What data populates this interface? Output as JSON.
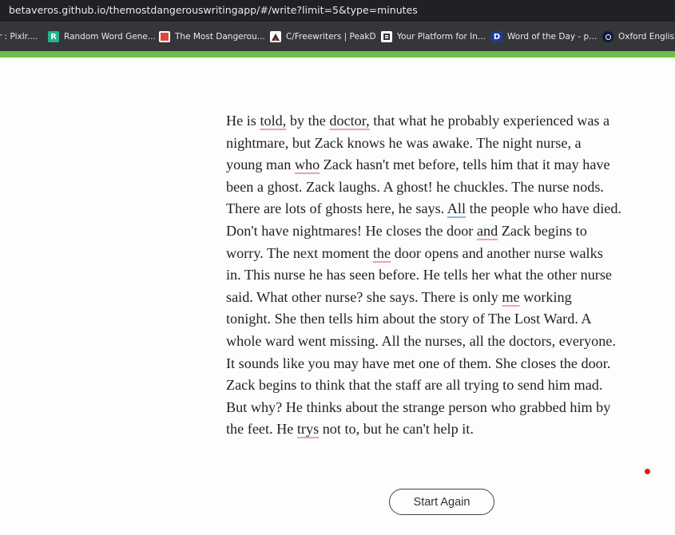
{
  "browser": {
    "url": "betaveros.github.io/themostdangerouswritingapp/#/write?limit=5&type=minutes",
    "bookmarks": [
      {
        "label": "r : Pixlr....",
        "icon": "pixlr-icon",
        "color": "#35363a"
      },
      {
        "label": "Random Word Gene...",
        "icon": "random-word-r-icon",
        "color": "#1fb58f",
        "letter": "R"
      },
      {
        "label": "The Most Dangerou...",
        "icon": "dangerous-writing-icon",
        "color": "#e0443b"
      },
      {
        "label": "C/Freewriters | PeakD",
        "icon": "peakd-icon",
        "color": "#ffffff"
      },
      {
        "label": "Your Platform for In...",
        "icon": "platform-b-icon",
        "color": "#ffffff"
      },
      {
        "label": "Word of the Day - p...",
        "icon": "dictionary-d-icon",
        "color": "#1a3d9c",
        "letter": "D"
      },
      {
        "label": "Oxford English",
        "icon": "oxford-icon",
        "color": "#0d1b3e"
      }
    ]
  },
  "progress": {
    "fraction": 1.0,
    "color": "#6cc04a"
  },
  "writing": {
    "lines": [
      [
        {
          "t": "He is "
        },
        {
          "t": "told,",
          "u": "sp"
        },
        {
          "t": " by the "
        },
        {
          "t": "doctor,",
          "u": "sp"
        },
        {
          "t": " that what he probably experienced was a"
        }
      ],
      [
        {
          "t": "nightmare, but Zack knows he was awake. The night nurse, a"
        }
      ],
      [
        {
          "t": "young man "
        },
        {
          "t": "who",
          "u": "sp"
        },
        {
          "t": " Zack hasn't met before, tells him that it may have"
        }
      ],
      [
        {
          "t": "been a ghost. Zack laughs. A ghost! he chuckles. The nurse nods."
        }
      ],
      [
        {
          "t": "There are lots of ghosts here, he says. "
        },
        {
          "t": "All",
          "u": "gr"
        },
        {
          "t": " the people who have died."
        }
      ],
      [
        {
          "t": "Don't have nightmares! He closes the door "
        },
        {
          "t": "and",
          "u": "sp"
        },
        {
          "t": " Zack begins to"
        }
      ],
      [
        {
          "t": "worry. The next moment "
        },
        {
          "t": "the",
          "u": "sp"
        },
        {
          "t": " door opens and another nurse walks"
        }
      ],
      [
        {
          "t": "in. This nurse he has seen before. He tells her what the other nurse"
        }
      ],
      [
        {
          "t": "said. What other nurse? she says. There is only "
        },
        {
          "t": "me",
          "u": "sp"
        },
        {
          "t": " working"
        }
      ],
      [
        {
          "t": "tonight. She then tells him about the story of The Lost Ward. A"
        }
      ],
      [
        {
          "t": "whole ward went missing. All the nurses, all the doctors, everyone."
        }
      ],
      [
        {
          "t": "It sounds like you may have met one of them. She closes the door."
        }
      ],
      [
        {
          "t": "Zack begins to think that the staff are all trying to send him mad."
        }
      ],
      [
        {
          "t": "But why? He thinks about the strange person who grabbed him by"
        }
      ],
      [
        {
          "t": "the feet. He "
        },
        {
          "t": "trys",
          "u": "sp"
        },
        {
          "t": " not to, but he can't help it."
        }
      ]
    ]
  },
  "action": {
    "start_again_label": "Start Again"
  },
  "colors": {
    "spell_underline": "#e7a3ba",
    "grammar_underline": "#8ab4f8",
    "status_dot": "#e0191b"
  }
}
